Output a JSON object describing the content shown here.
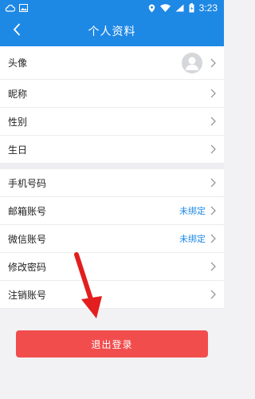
{
  "status_bar": {
    "time": "3:23",
    "icons": [
      "cloud-icon",
      "image-icon",
      "location-icon",
      "wifi-icon",
      "signal-icon",
      "battery-icon"
    ]
  },
  "header": {
    "title": "个人资料",
    "back_icon": "chevron-left-icon"
  },
  "profile_group": {
    "rows": [
      {
        "label": "头像",
        "type": "avatar"
      },
      {
        "label": "昵称",
        "value": ""
      },
      {
        "label": "性别",
        "value": ""
      },
      {
        "label": "生日",
        "value": ""
      }
    ]
  },
  "account_group": {
    "rows": [
      {
        "label": "手机号码",
        "value": ""
      },
      {
        "label": "邮箱账号",
        "value": "未绑定"
      },
      {
        "label": "微信账号",
        "value": "未绑定"
      },
      {
        "label": "修改密码",
        "value": ""
      },
      {
        "label": "注销账号",
        "value": ""
      }
    ]
  },
  "logout_button": {
    "label": "退出登录"
  },
  "colors": {
    "primary": "#1e88e5",
    "danger": "#f24d4d",
    "annotation_arrow": "#e21e1e"
  }
}
